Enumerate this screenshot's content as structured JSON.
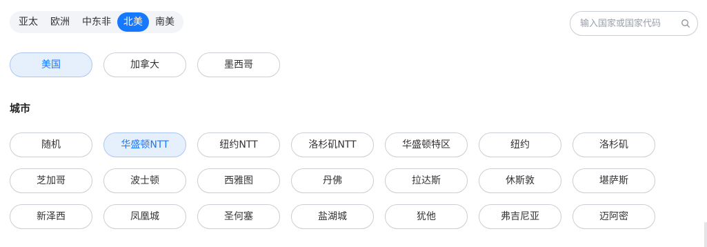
{
  "regions": {
    "tabs": [
      "亚太",
      "欧洲",
      "中东非",
      "北美",
      "南美"
    ],
    "active": "北美"
  },
  "search": {
    "placeholder": "输入国家或国家代码",
    "icon": "search-icon"
  },
  "countries": {
    "items": [
      "美国",
      "加拿大",
      "墨西哥"
    ],
    "selected": "美国"
  },
  "cities": {
    "title": "城市",
    "items": [
      "随机",
      "华盛顿NTT",
      "纽约NTT",
      "洛杉矶NTT",
      "华盛顿特区",
      "纽约",
      "洛杉矶",
      "芝加哥",
      "波士顿",
      "西雅图",
      "丹佛",
      "拉达斯",
      "休斯敦",
      "堪萨斯",
      "新泽西",
      "凤凰城",
      "圣何塞",
      "盐湖城",
      "犹他",
      "弗吉尼亚",
      "迈阿密"
    ],
    "selected": "华盛顿NTT"
  },
  "colors": {
    "accent": "#1677ff",
    "selected_bg": "#e6f0fd",
    "border": "#c9cdd4"
  }
}
